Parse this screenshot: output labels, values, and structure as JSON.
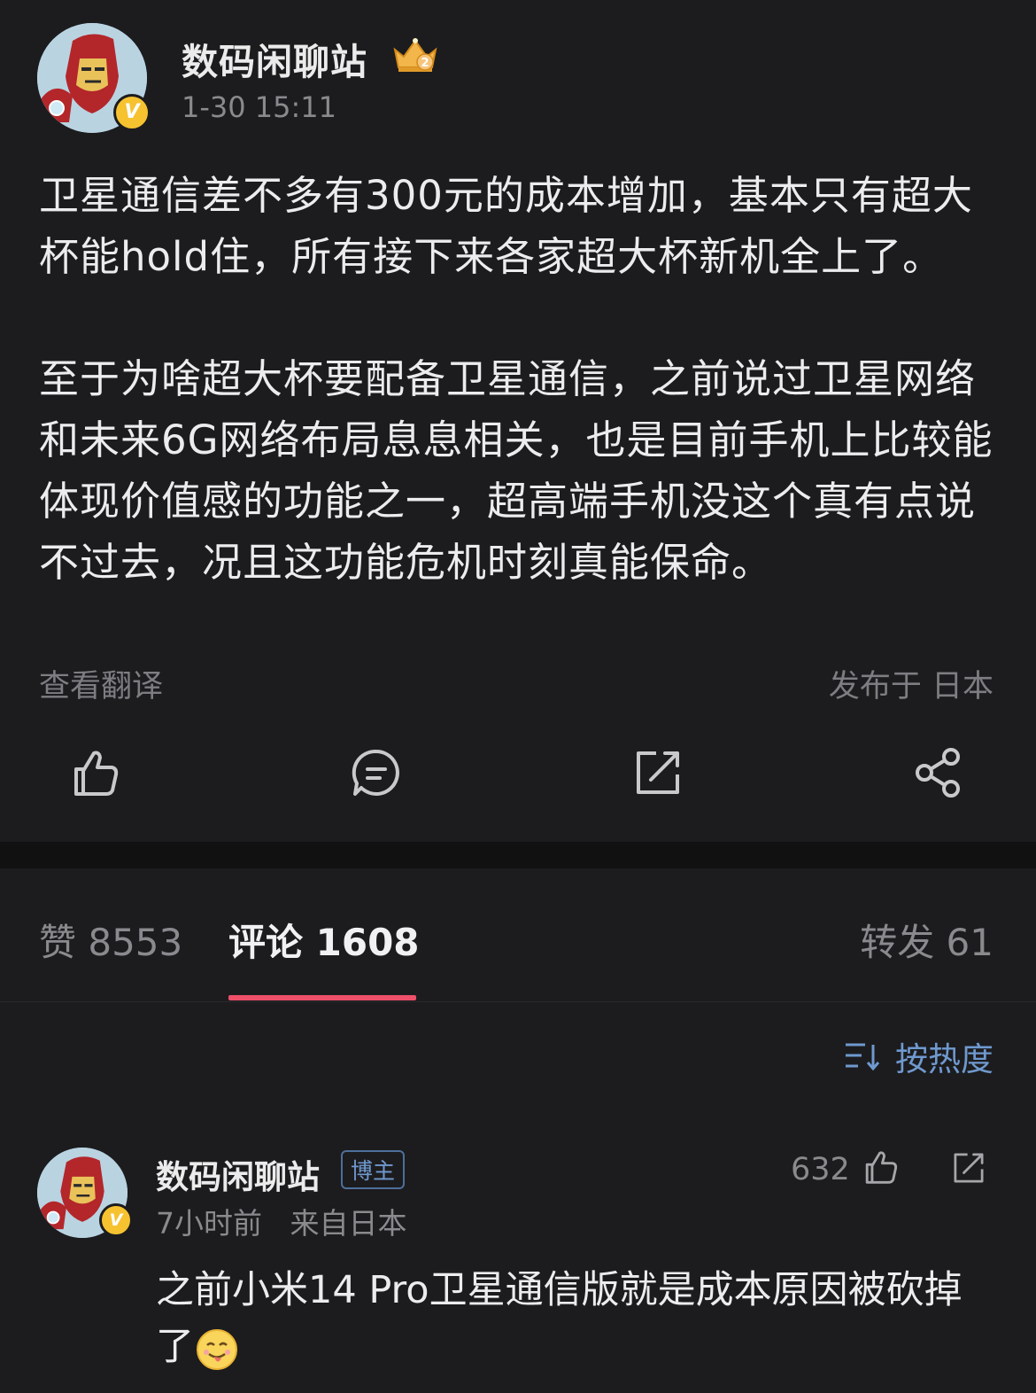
{
  "post": {
    "author": "数码闲聊站",
    "time": "1-30 15:11",
    "paragraph1": "卫星通信差不多有300元的成本增加，基本只有超大杯能hold住，所有接下来各家超大杯新机全上了。",
    "paragraph2": "至于为啥超大杯要配备卫星通信，之前说过卫星网络和未来6G网络布局息息相关，也是目前手机上比较能体现价值感的功能之一，超高端手机没这个真有点说不过去，况且这功能危机时刻真能保命。",
    "translate_label": "查看翻译",
    "location": "发布于 日本",
    "verified_mark": "V",
    "crown_level": "2"
  },
  "actions": {
    "like_icon": "thumbs-up-icon",
    "comment_icon": "comment-icon",
    "repost_icon": "repost-icon",
    "share_icon": "share-icon"
  },
  "tabs": {
    "likes": "赞 8553",
    "comments": "评论 1608",
    "reposts": "转发 61"
  },
  "sort": {
    "label": "按热度",
    "icon": "sort-icon"
  },
  "comment": {
    "author": "数码闲聊站",
    "badge": "博主",
    "time": "7小时前",
    "source": "来自日本",
    "likes": "632",
    "text": "之前小米14 Pro卫星通信版就是成本原因被砍掉了",
    "emoji": "tongue-face-emoji"
  },
  "colors": {
    "background": "#1c1c1e",
    "accent_underline": "#ee4f69",
    "link_blue": "#6f99cf",
    "verified": "#f6c230"
  }
}
